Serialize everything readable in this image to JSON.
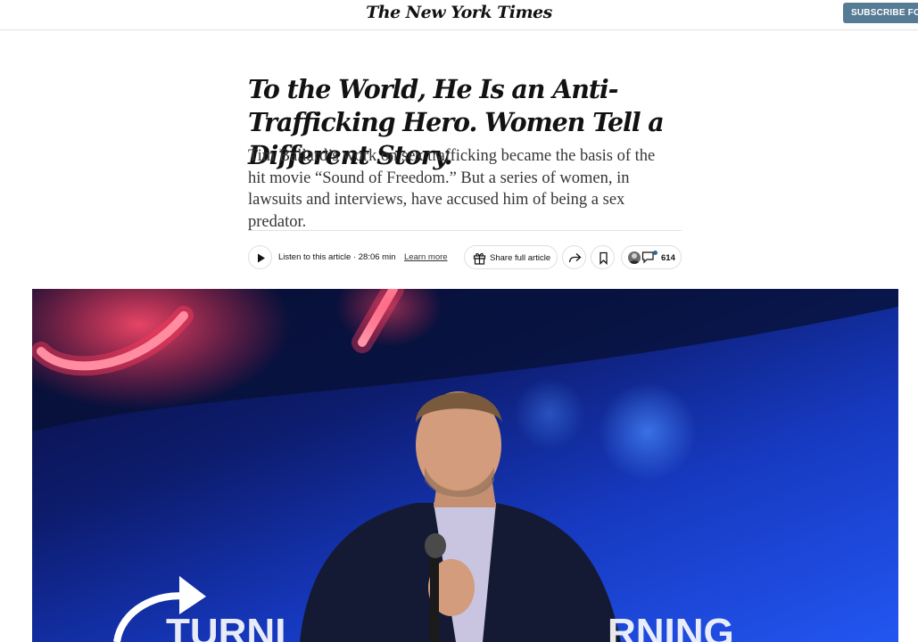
{
  "header": {
    "masthead": "The New York Times",
    "subscribe_label": "SUBSCRIBE FOR"
  },
  "article": {
    "headline": "To the World, He Is an Anti-Trafficking Hero. Women Tell a Different Story.",
    "summary": "Tim Ballard’s work on sex trafficking became the basis of the hit movie “Sound of Freedom.” But a series of women, in lawsuits and interviews, have accused him of being a sex predator."
  },
  "toolbar": {
    "listen_label": "Listen to this article · 28:06 min",
    "learn_more": "Learn more",
    "share_full": "Share full article",
    "comment_count": "614"
  },
  "photo": {
    "stage_text": "TURNI",
    "stage_text_right": "RNING"
  },
  "icons": {
    "play": "play-icon",
    "gift": "gift-icon",
    "share": "share-arrow-icon",
    "bookmark": "bookmark-icon",
    "comment": "comment-icon"
  },
  "colors": {
    "subscribe_bg": "#567b95",
    "text": "#121212",
    "border": "#dfdfdf"
  }
}
